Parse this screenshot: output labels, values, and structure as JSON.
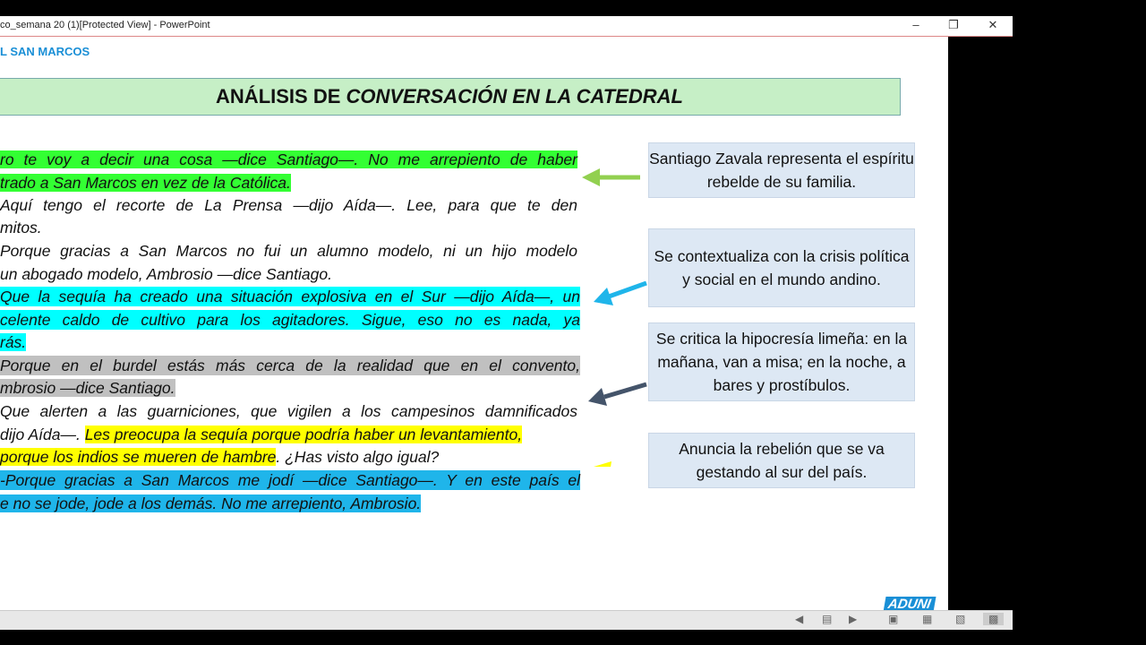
{
  "window": {
    "title": "co_semana 20 (1)[Protected View] - PowerPoint"
  },
  "slide": {
    "brand": "L SAN MARCOS",
    "heading_pre": "ANÁLISIS DE ",
    "heading_em": "CONVERSACIÓN EN LA CATEDRAL",
    "lines": [
      "ro te voy a decir una cosa —dice Santiago—. No me arrepiento de haber",
      "trado a San Marcos en vez de la Católica.",
      "Aquí tengo el recorte de La Prensa —dijo Aída—. Lee, para que te den",
      "mitos.",
      "Porque gracias a San Marcos no fui un alumno modelo, ni un hijo modelo",
      "un abogado modelo, Ambrosio —dice Santiago.",
      "Que la sequía ha creado una situación explosiva en el Sur —dijo Aída—, un",
      "celente caldo de cultivo para los agitadores. Sigue, eso no es nada, ya",
      "rás.",
      "Porque en el burdel estás más cerca de la realidad que en el convento,",
      "mbrosio —dice Santiago.",
      "Que alerten a las guarniciones, que vigilen a los campesinos damnificados",
      "dijo Aída—. ",
      "Les preocupa la sequía porque podría haber un levantamiento,",
      "porque los indios se mueren de hambre",
      ". ¿Has visto algo igual?",
      "-Porque gracias a San Marcos me jodí —dice Santiago—. Y en este país el",
      "e no se jode, jode a los demás. No me arrepiento, Ambrosio."
    ],
    "notes": [
      "Santiago Zavala representa el espíritu rebelde de su familia.",
      "Se contextualiza con la crisis política y social en el mundo andino.",
      "Se critica la hipocresía limeña: en la mañana, van a misa; en la noche, a bares y prostíbulos.",
      "Anuncia la rebelión que se va gestando al sur del país."
    ],
    "logo": "ADUNI"
  },
  "colors": {
    "green": "#33ff33",
    "cyan": "#00ffff",
    "gray": "#c0c0c0",
    "yellow": "#ffff00",
    "blue": "#1fb5ea"
  }
}
